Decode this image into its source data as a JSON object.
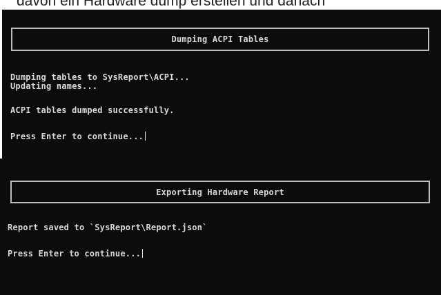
{
  "caption": {
    "text": "davon ein Hardware dump erstellen und danach"
  },
  "acpi_section": {
    "banner_title": "Dumping ACPI Tables",
    "lines": [
      "Dumping tables to SysReport\\ACPI...",
      "Updating names...",
      "ACPI tables dumped successfully.",
      "Press Enter to continue..."
    ]
  },
  "report_section": {
    "banner_title": "Exporting Hardware Report",
    "lines": [
      "Report saved to `SysReport\\Report.json`",
      "Press Enter to continue..."
    ]
  },
  "colors": {
    "terminal_background": "#0c0c0c",
    "terminal_text": "#d8d8d8",
    "banner_border": "#bdbdbd"
  }
}
